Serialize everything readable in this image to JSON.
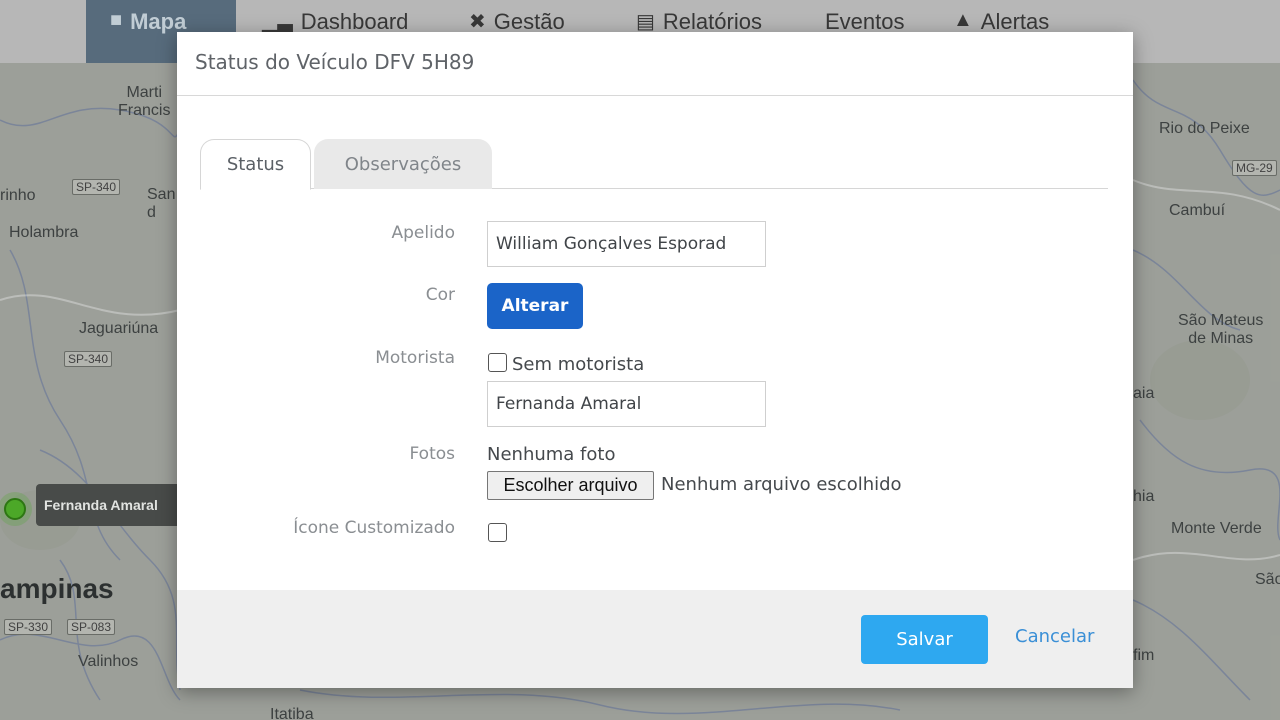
{
  "nav": {
    "items": [
      {
        "label": "Mapa",
        "icon": "map-icon"
      },
      {
        "label": "Dashboard",
        "icon": "bar-chart-icon"
      },
      {
        "label": "Gestão",
        "icon": "tools-icon"
      },
      {
        "label": "Relatórios",
        "icon": "document-icon"
      },
      {
        "label": "Eventos",
        "icon": ""
      },
      {
        "label": "Alertas",
        "icon": "bell-icon"
      }
    ],
    "active": "Mapa"
  },
  "map": {
    "labels": {
      "martins_francisco": "Marti\nFrancis",
      "rinho": "rinho",
      "holambra": "Holambra",
      "santo": "San\nd",
      "jaguariuna": "Jaguariúna",
      "campinas": "ampinas",
      "valinhos": "Valinhos",
      "itatiba": "Itatiba",
      "rio_do_peixe": "Rio do Peixe",
      "cambui": "Cambuí",
      "sao_mateus": "São Mateus\nde Minas",
      "aia": "aia",
      "hia": "hia",
      "monte_verde": "Monte Verde",
      "sao": "São",
      "fim": "fim"
    },
    "roads": {
      "sp340_a": "SP-340",
      "sp340_b": "SP-340",
      "sp330": "SP-330",
      "sp083": "SP-083",
      "mg29": "MG-29"
    },
    "vehicle_tag": "Fernanda Amaral",
    "colors": {
      "background": "#a2a59e",
      "marker": "#4fae2a"
    }
  },
  "modal": {
    "title": "Status do Veículo DFV 5H89",
    "tabs": [
      {
        "label": "Status",
        "active": true
      },
      {
        "label": "Observações",
        "active": false
      }
    ],
    "form": {
      "apelido_label": "Apelido",
      "apelido_value": "William Gonçalves Esporad",
      "cor_label": "Cor",
      "cor_button": "Alterar",
      "motorista_label": "Motorista",
      "sem_motorista_label": "Sem motorista",
      "sem_motorista_checked": false,
      "motorista_value": "Fernanda Amaral",
      "fotos_label": "Fotos",
      "fotos_status": "Nenhuma foto",
      "file_button": "Escolher arquivo",
      "file_status": "Nenhum arquivo escolhido",
      "icone_label": "Ícone Customizado",
      "icone_checked": false
    },
    "footer": {
      "save": "Salvar",
      "cancel": "Cancelar"
    },
    "colors": {
      "primary": "#1b64c8",
      "save": "#2ea8f0",
      "link": "#3a8fd6"
    }
  }
}
